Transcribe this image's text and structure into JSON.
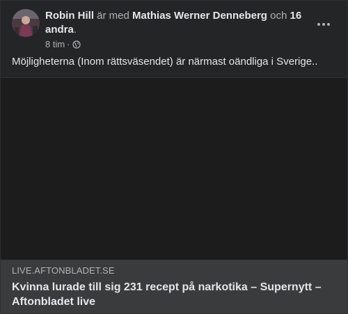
{
  "post": {
    "author": "Robin Hill",
    "with_text": "är med",
    "tagged_person": "Mathias Werner Denneberg",
    "and_text": "och",
    "others": "16 andra",
    "period": ".",
    "timestamp": "8 tim",
    "separator": "·",
    "audience_icon": "globe-icon",
    "more_icon": "more-horizontal-icon",
    "message": "Möjligheterna (Inom rättsväsendet) är närmast oändliga i Sverige.."
  },
  "link_preview": {
    "domain": "LIVE.AFTONBLADET.SE",
    "title": "Kvinna lurade till sig 231 recept på narkotika – Supernytt – Aftonbladet live"
  },
  "colors": {
    "background": "#242526",
    "preview_bg": "#3a3b3c",
    "text_primary": "#e4e6eb",
    "text_secondary": "#b0b3b8"
  }
}
